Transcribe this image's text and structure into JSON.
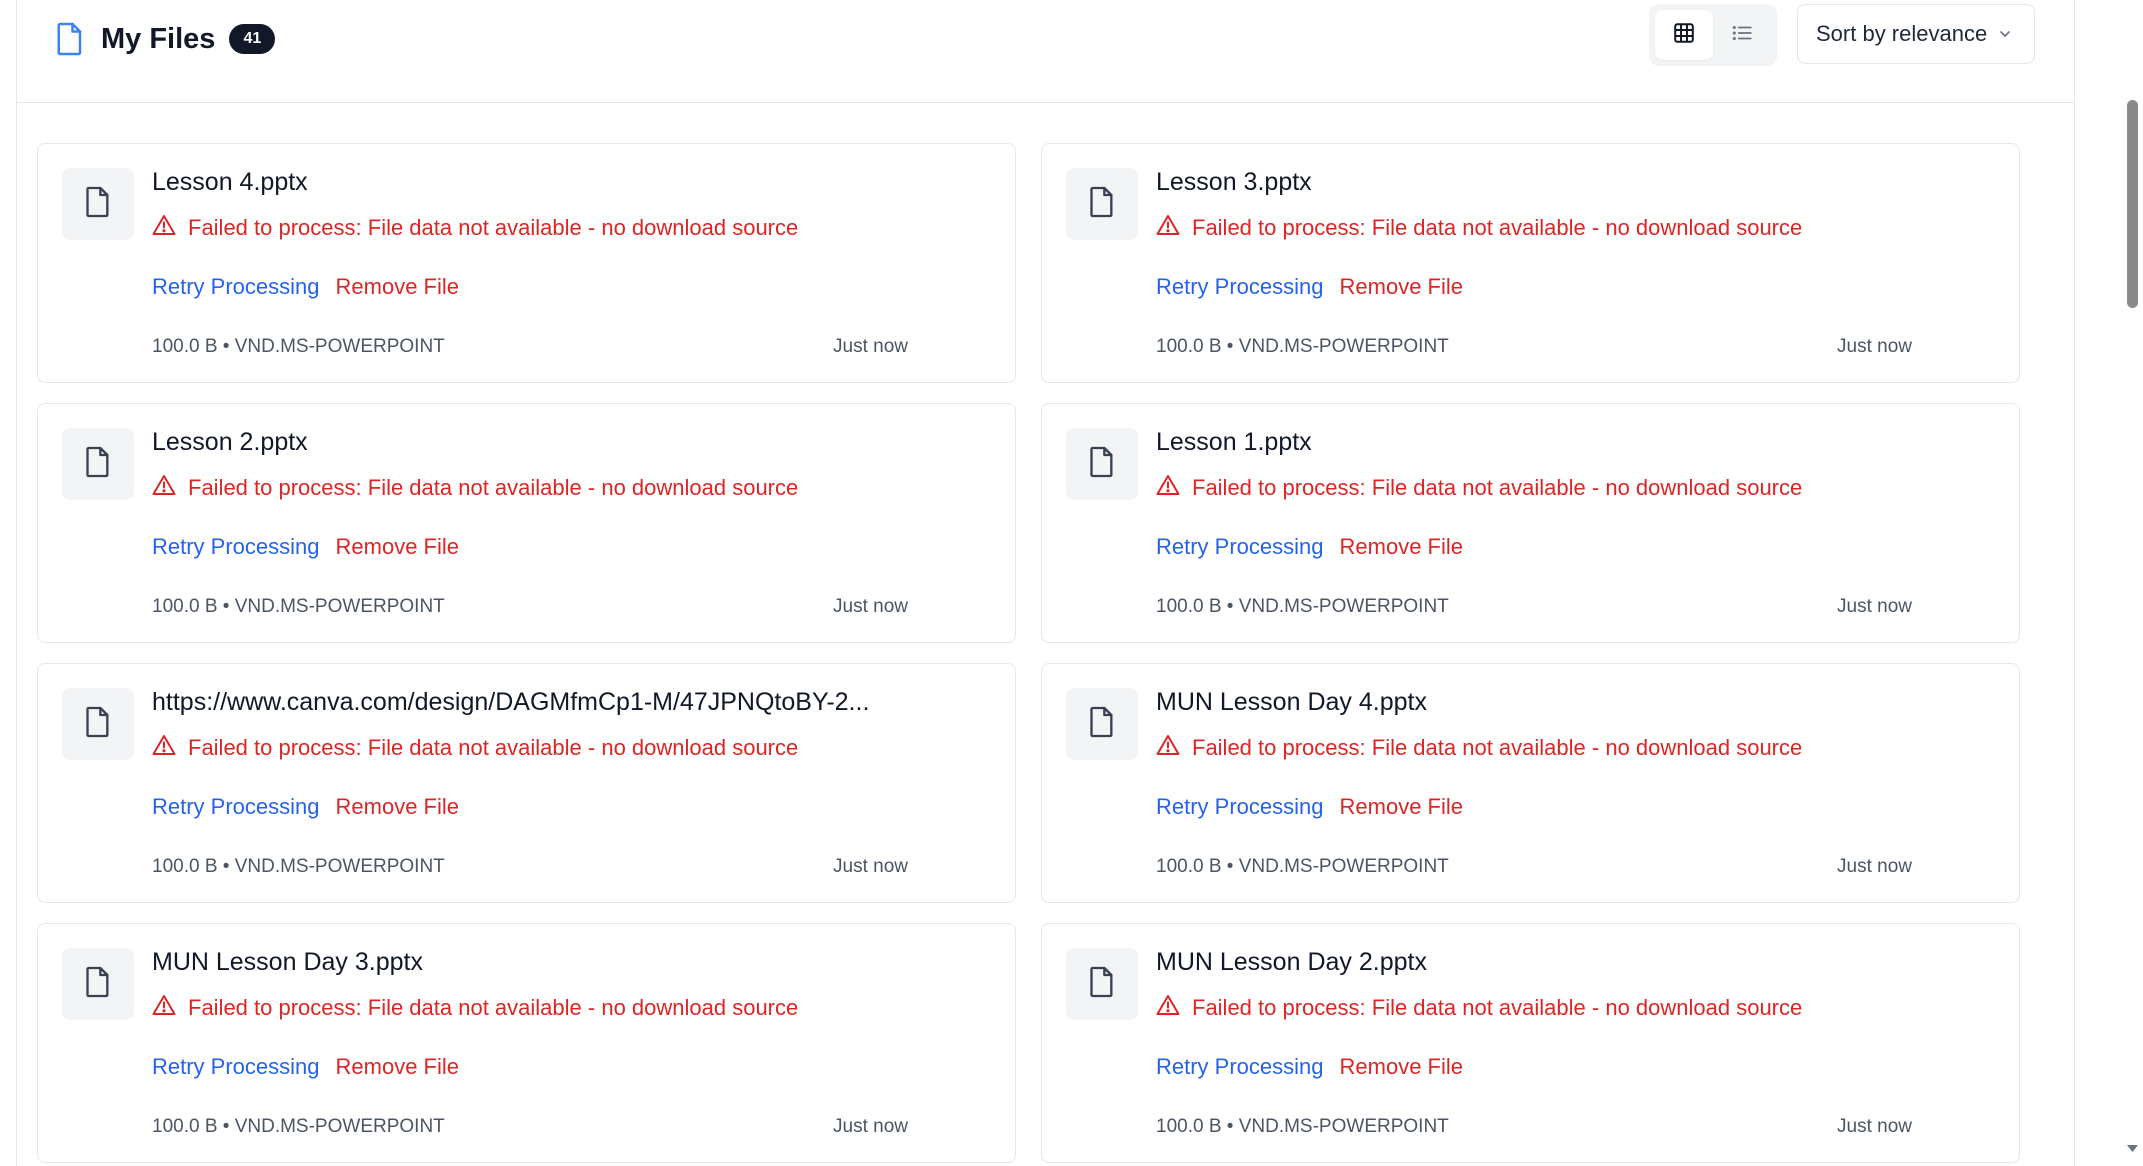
{
  "header": {
    "title": "My Files",
    "count": "41",
    "sort_label": "Sort by relevance",
    "view_modes": [
      "grid-icon",
      "list-icon"
    ]
  },
  "actions": {
    "retry_label": "Retry Processing",
    "remove_label": "Remove File"
  },
  "files": [
    {
      "name": "Lesson 4.pptx",
      "error": "Failed to process: File data not available - no download source",
      "meta": "100.0 B • VND.MS-POWERPOINT",
      "time": "Just now"
    },
    {
      "name": "Lesson 3.pptx",
      "error": "Failed to process: File data not available - no download source",
      "meta": "100.0 B • VND.MS-POWERPOINT",
      "time": "Just now"
    },
    {
      "name": "Lesson 2.pptx",
      "error": "Failed to process: File data not available - no download source",
      "meta": "100.0 B • VND.MS-POWERPOINT",
      "time": "Just now"
    },
    {
      "name": "Lesson 1.pptx",
      "error": "Failed to process: File data not available - no download source",
      "meta": "100.0 B • VND.MS-POWERPOINT",
      "time": "Just now"
    },
    {
      "name": "https://www.canva.com/design/DAGMfmCp1-M/47JPNQtoBY-2...",
      "error": "Failed to process: File data not available - no download source",
      "meta": "100.0 B • VND.MS-POWERPOINT",
      "time": "Just now"
    },
    {
      "name": "MUN Lesson Day 4.pptx",
      "error": "Failed to process: File data not available - no download source",
      "meta": "100.0 B • VND.MS-POWERPOINT",
      "time": "Just now"
    },
    {
      "name": "MUN Lesson Day 3.pptx",
      "error": "Failed to process: File data not available - no download source",
      "meta": "100.0 B • VND.MS-POWERPOINT",
      "time": "Just now"
    },
    {
      "name": "MUN Lesson Day 2.pptx",
      "error": "Failed to process: File data not available - no download source",
      "meta": "100.0 B • VND.MS-POWERPOINT",
      "time": "Just now"
    }
  ],
  "colors": {
    "error": "#dc2626",
    "link": "#2563eb",
    "badge": "#111827",
    "accent": "#2563eb"
  }
}
